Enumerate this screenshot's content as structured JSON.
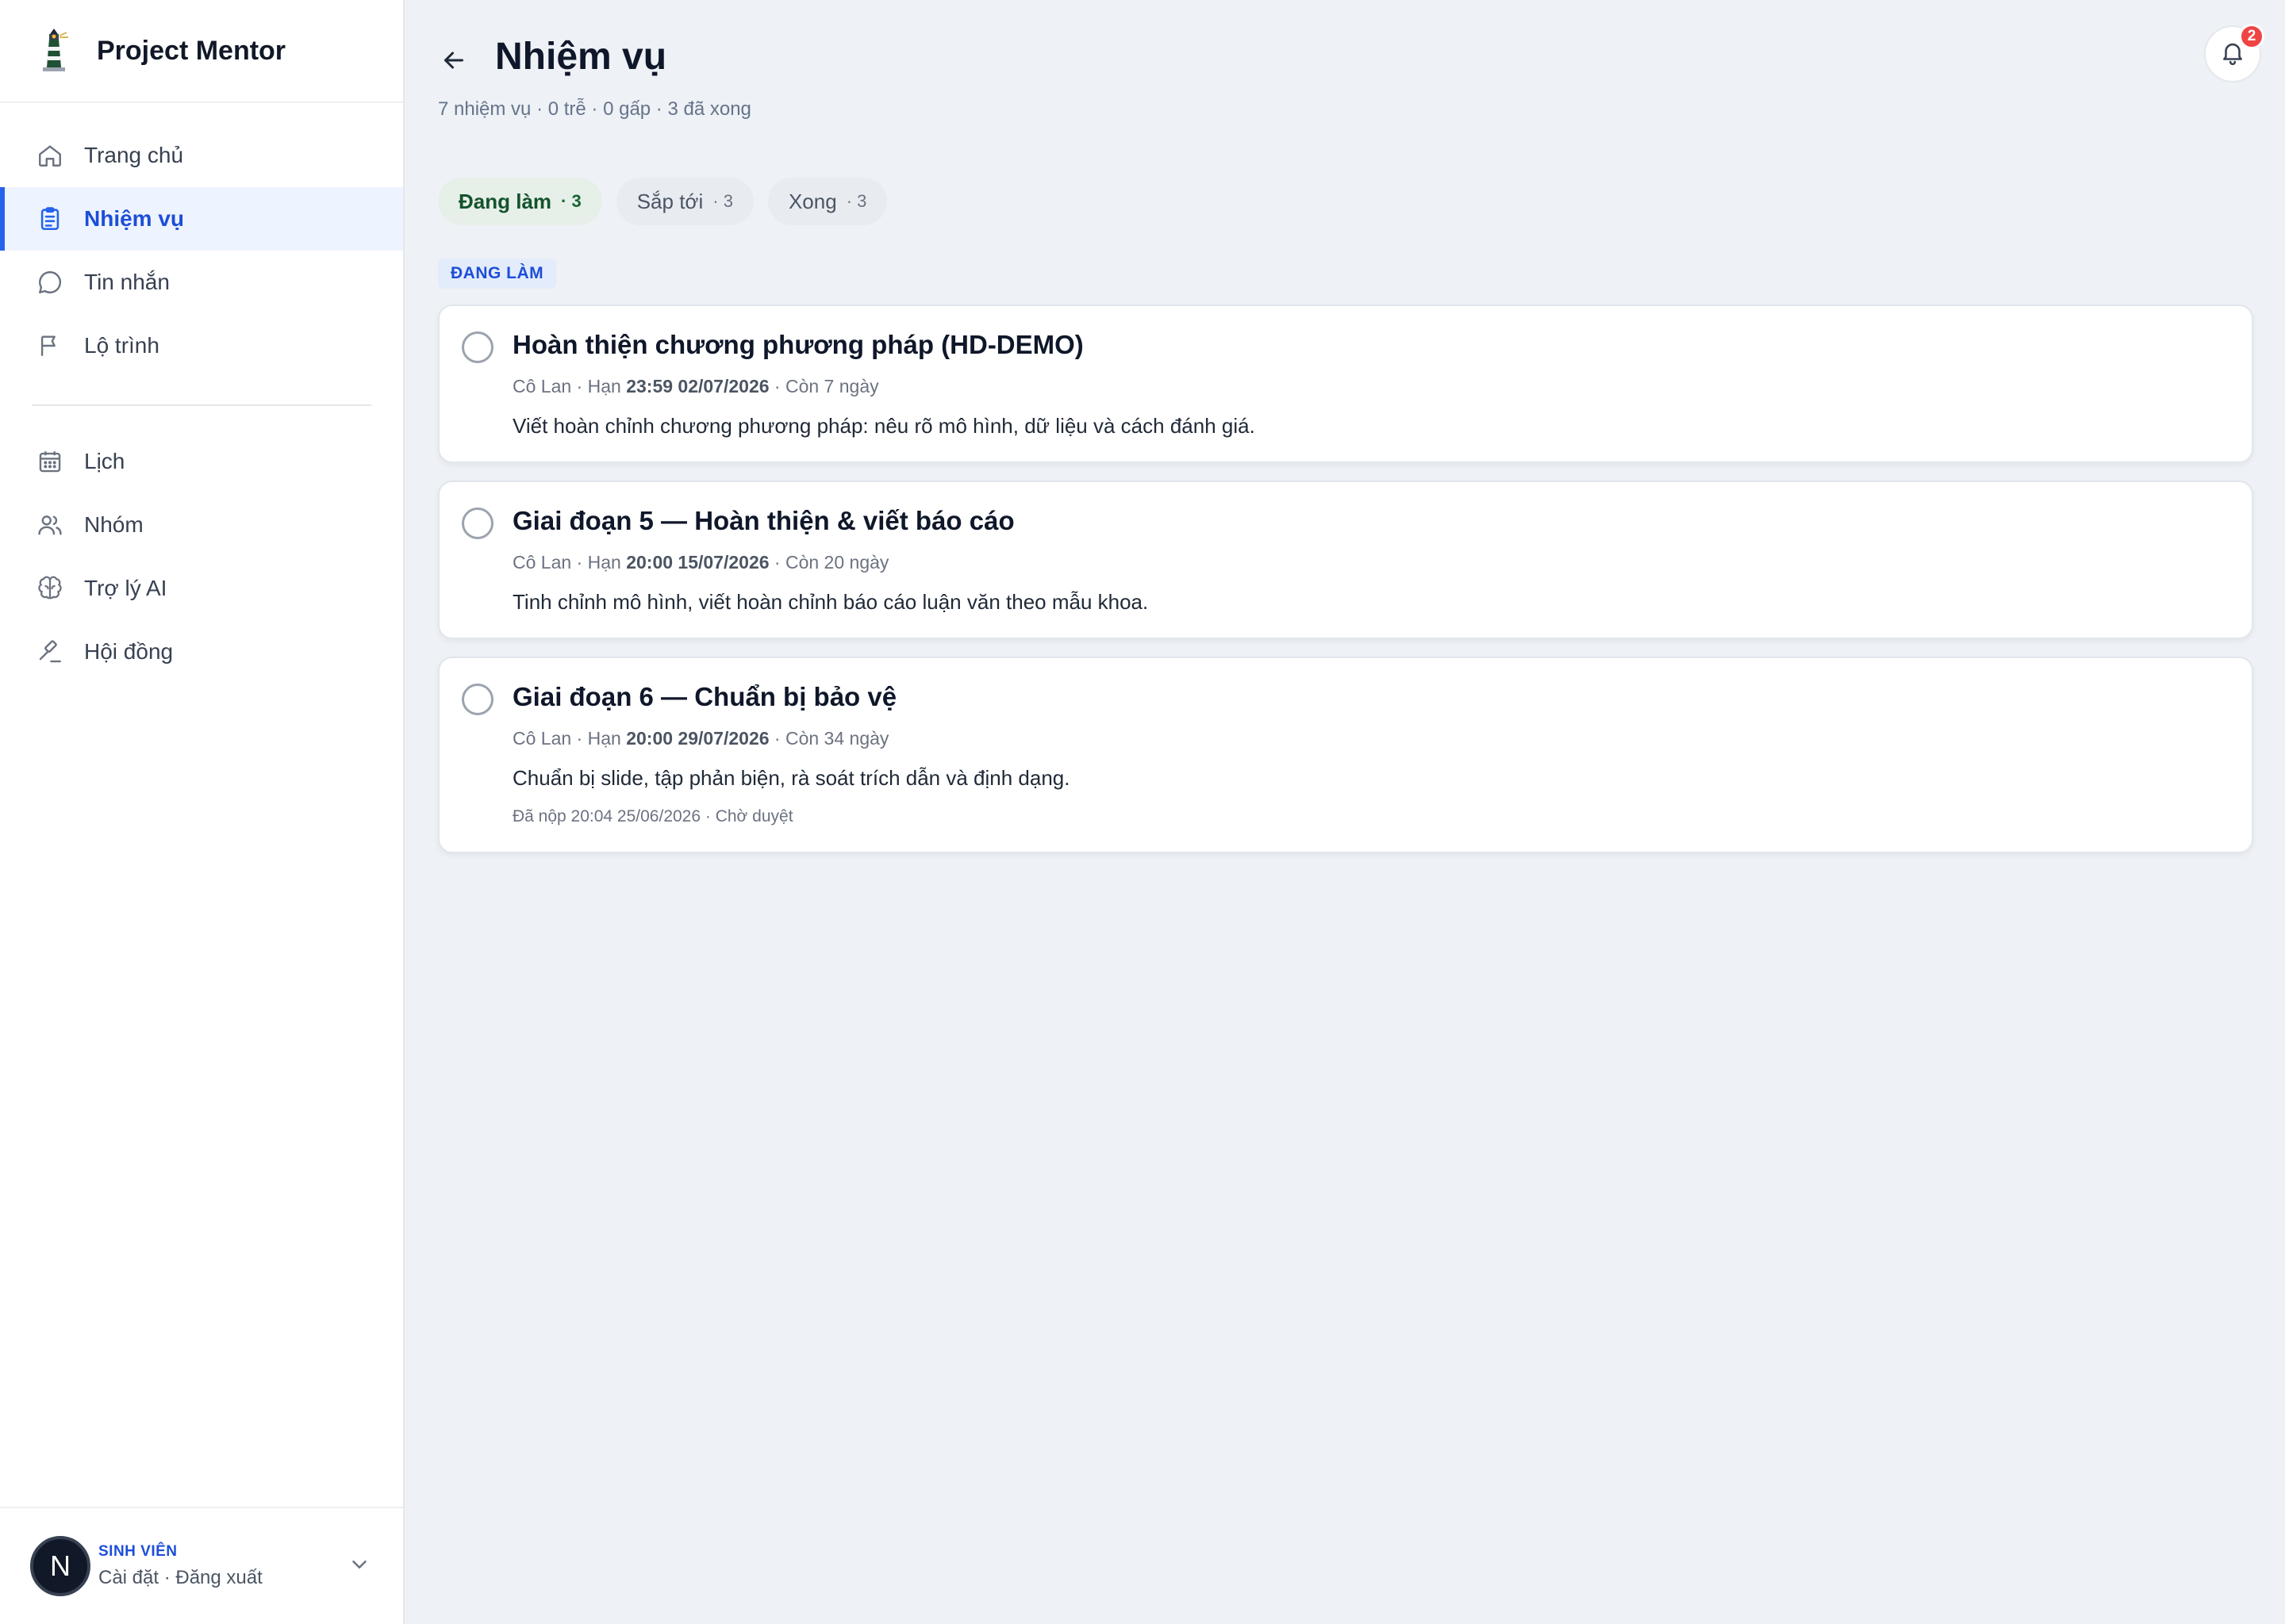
{
  "brand": {
    "name": "Project Mentor"
  },
  "nav": {
    "primary": [
      {
        "label": "Trang chủ",
        "icon": "home-icon"
      },
      {
        "label": "Nhiệm vụ",
        "icon": "clipboard-icon",
        "active": true
      },
      {
        "label": "Tin nhắn",
        "icon": "chat-bubble-icon"
      },
      {
        "label": "Lộ trình",
        "icon": "flag-icon"
      }
    ],
    "secondary": [
      {
        "label": "Lịch",
        "icon": "calendar-icon"
      },
      {
        "label": "Nhóm",
        "icon": "users-icon"
      },
      {
        "label": "Trợ lý AI",
        "icon": "brain-icon"
      },
      {
        "label": "Hội đồng",
        "icon": "gavel-icon"
      }
    ]
  },
  "user": {
    "initial": "N",
    "role": "SINH VIÊN",
    "links": "Cài đặt · Đăng xuất"
  },
  "header": {
    "title": "Nhiệm vụ",
    "summary": "7 nhiệm vụ · 0 trễ · 0 gấp · 3 đã xong",
    "notifications": "2"
  },
  "tabs": [
    {
      "label": "Đang làm",
      "count": "· 3",
      "active": true
    },
    {
      "label": "Sắp tới",
      "count": "· 3"
    },
    {
      "label": "Xong",
      "count": "· 3"
    }
  ],
  "section": {
    "label": "ĐANG LÀM"
  },
  "tasks": [
    {
      "title": "Hoàn thiện chương phương pháp (HD-DEMO)",
      "meta_prefix": "Cô Lan · Hạn ",
      "deadline": "23:59 02/07/2026",
      "meta_suffix": " · Còn 7 ngày",
      "description": "Viết hoàn chỉnh chương phương pháp: nêu rõ mô hình, dữ liệu và cách đánh giá.",
      "note": ""
    },
    {
      "title": "Giai đoạn 5 — Hoàn thiện & viết báo cáo",
      "meta_prefix": "Cô Lan · Hạn ",
      "deadline": "20:00 15/07/2026",
      "meta_suffix": " · Còn 20 ngày",
      "description": "Tinh chỉnh mô hình, viết hoàn chỉnh báo cáo luận văn theo mẫu khoa.",
      "note": ""
    },
    {
      "title": "Giai đoạn 6 — Chuẩn bị bảo vệ",
      "meta_prefix": "Cô Lan · Hạn ",
      "deadline": "20:00 29/07/2026",
      "meta_suffix": " · Còn 34 ngày",
      "description": "Chuẩn bị slide, tập phản biện, rà soát trích dẫn và định dạng.",
      "note": "Đã nộp 20:04 25/06/2026 · Chờ duyệt"
    }
  ],
  "colors": {
    "accent": "#2563eb",
    "active_tab_bg": "#e6efe8",
    "badge": "#ef4444"
  }
}
